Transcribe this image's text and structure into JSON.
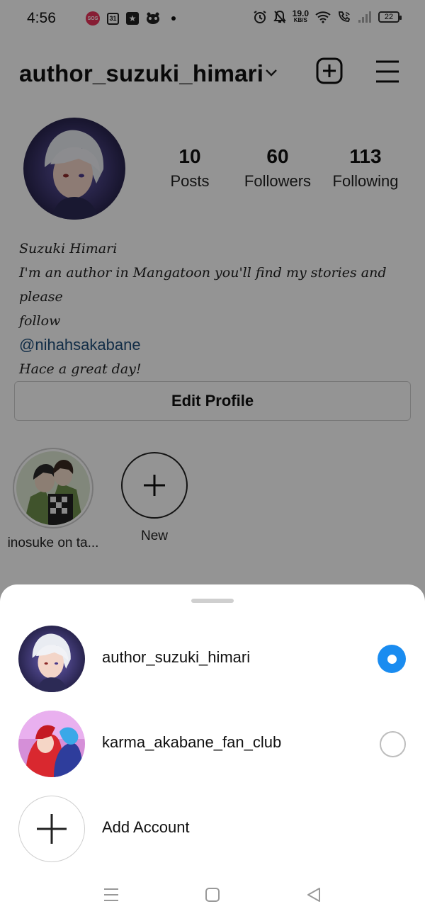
{
  "status_bar": {
    "time": "4:56",
    "sos_label": "SOS",
    "calendar_day": "31",
    "net_speed_value": "19.0",
    "net_speed_unit": "KB/S",
    "battery": "22"
  },
  "header": {
    "username": "author_suzuki_himari"
  },
  "profile": {
    "stats": [
      {
        "value": "10",
        "label": "Posts"
      },
      {
        "value": "60",
        "label": "Followers"
      },
      {
        "value": "113",
        "label": "Following"
      }
    ],
    "bio_name": "Suzuki Himari",
    "bio_line1": "I'm an author in Mangatoon you'll find my stories and please",
    "bio_line2": "follow",
    "bio_mention": "@nihahsakabane",
    "bio_line3": "Hace a great day!",
    "edit_button": "Edit Profile"
  },
  "highlights": [
    {
      "label": "inosuke on ta..."
    },
    {
      "label": "New"
    }
  ],
  "account_sheet": {
    "accounts": [
      {
        "username": "author_suzuki_himari",
        "selected": true
      },
      {
        "username": "karma_akabane_fan_club",
        "selected": false
      }
    ],
    "add_account_label": "Add Account"
  },
  "colors": {
    "accent": "#1a8cf0",
    "mention": "#1f4f7a",
    "scrim": "rgba(0,0,0,0.42)"
  },
  "icons": [
    "sos-icon",
    "calendar-icon",
    "star-icon",
    "game-icon",
    "alarm-icon",
    "mute-icon",
    "wifi-icon",
    "wifi-call-icon",
    "signal-icon",
    "battery-icon",
    "chevron-down-icon",
    "add-post-icon",
    "menu-icon",
    "plus-icon",
    "nav-menu-icon",
    "nav-home-icon",
    "nav-back-icon"
  ]
}
